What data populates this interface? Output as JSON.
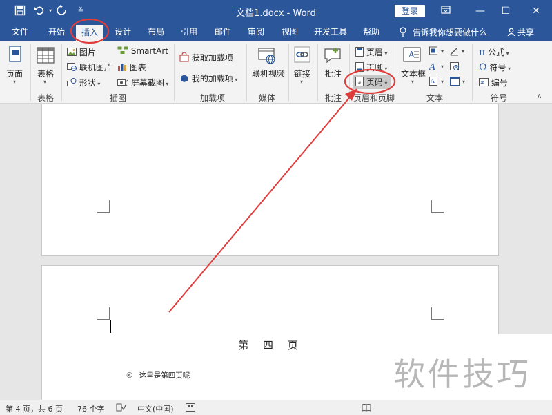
{
  "titlebar": {
    "title": "文档1.docx - Word",
    "login": "登录"
  },
  "tabs": [
    "文件",
    "开始",
    "插入",
    "设计",
    "布局",
    "引用",
    "邮件",
    "审阅",
    "视图",
    "开发工具",
    "帮助"
  ],
  "active_tab": "插入",
  "tell_me": "告诉我你想要做什么",
  "share": "共享",
  "ribbon": {
    "pages": {
      "label": "页面",
      "group": ""
    },
    "tables": {
      "label": "表格",
      "group": "表格"
    },
    "illustrations": {
      "picture": "图片",
      "online_picture": "联机图片",
      "shapes": "形状",
      "smartart": "SmartArt",
      "chart": "图表",
      "screenshot": "屏幕截图",
      "group": "插图"
    },
    "addins": {
      "get": "获取加载项",
      "mine": "我的加载项",
      "group": "加载项"
    },
    "media": {
      "online_video": "联机视频",
      "group": "媒体"
    },
    "links": {
      "label": "链接"
    },
    "comments": {
      "label": "批注",
      "group": "批注"
    },
    "header_footer": {
      "header": "页眉",
      "footer": "页脚",
      "page_number": "页码",
      "group": "页眉和页脚"
    },
    "text": {
      "textbox": "文本框",
      "group": "文本"
    },
    "symbols": {
      "equation": "公式",
      "symbol": "符号",
      "number": "编号",
      "group": "符号"
    }
  },
  "document": {
    "heading": "第 四 页",
    "paragraph_marker": "④",
    "paragraph_text": "这里是第四页呢"
  },
  "statusbar": {
    "page": "第 4 页，共 6 页",
    "words": "76 个字",
    "language": "中文(中国)"
  },
  "watermark": "软件技巧",
  "colors": {
    "brand": "#2b579a",
    "annotation": "#e03c3c"
  }
}
